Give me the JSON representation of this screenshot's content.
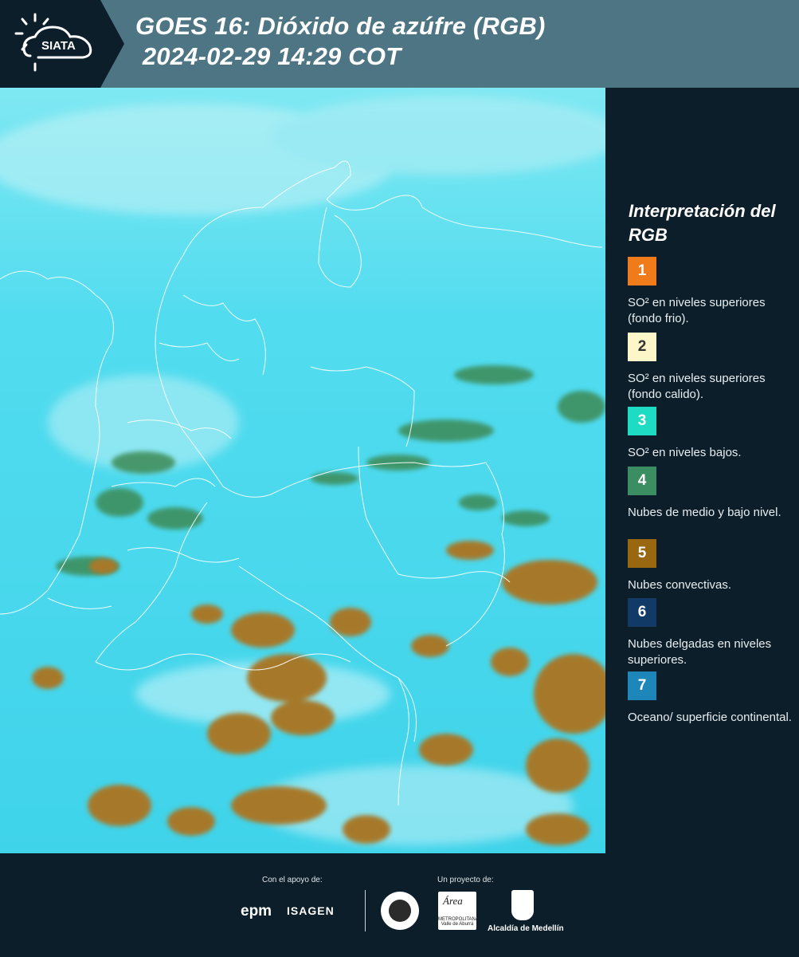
{
  "header": {
    "logo_text": "SIATA",
    "title_line1": "GOES 16: Dióxido de azúfre (RGB)",
    "title_line2": " 2024-02-29 14:29 COT"
  },
  "colors": {
    "header_bg": "#4e7583",
    "page_bg": "#0c1e2a",
    "sea_cyan": "#3fd7ee",
    "convective_brown": "#a6792a",
    "midlow_green": "#3d8a55"
  },
  "legend": {
    "title": "Interpretación del RGB",
    "items": [
      {
        "number": "1",
        "color": "#f07b1a",
        "label": "SO² en niveles superiores (fondo frio)."
      },
      {
        "number": "2",
        "color": "#fdf6c8",
        "label": "SO² en niveles superiores (fondo calido)."
      },
      {
        "number": "3",
        "color": "#1ddcc3",
        "label": "SO² en niveles bajos."
      },
      {
        "number": "4",
        "color": "#3b8e62",
        "label": "Nubes de medio y bajo nivel."
      },
      {
        "number": "5",
        "color": "#99670f",
        "label": "Nubes convectivas."
      },
      {
        "number": "6",
        "color": "#123a66",
        "label": "Nubes delgadas en niveles superiores."
      },
      {
        "number": "7",
        "color": "#1c87b8",
        "label": "Oceano/ superficie continental."
      }
    ]
  },
  "footer": {
    "support_label": "Con el apoyo de:",
    "project_label": "Un proyecto de:",
    "epm_logo": "epm",
    "isagen_logo": "ISAGEN",
    "area_logo": "Área",
    "area_subtext": "METROPOLITANA Valle de Aburrá",
    "alcaldia_label": "Alcaldía de Medellín"
  }
}
